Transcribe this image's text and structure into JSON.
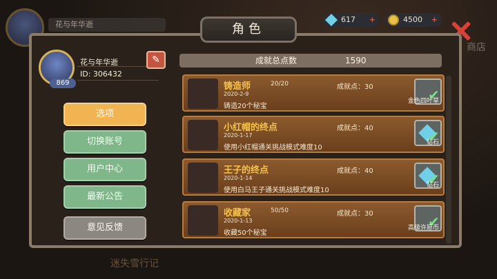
{
  "background": {
    "player_name": "花与年华逝",
    "shop_label": "商店",
    "bottom_text": "迷失雪行记"
  },
  "currency": {
    "gems": "617",
    "coins": "4500",
    "plus": "+"
  },
  "panel": {
    "title": "角色"
  },
  "profile": {
    "name": "花与年华逝",
    "id_label": "ID: 306432",
    "level": "869",
    "edit_icon": "pencil-icon"
  },
  "menu": [
    {
      "label": "选项",
      "state": "active"
    },
    {
      "label": "切换账号",
      "state": "normal"
    },
    {
      "label": "用户中心",
      "state": "normal"
    },
    {
      "label": "最新公告",
      "state": "normal"
    },
    {
      "label": "意见反馈",
      "state": "disabled"
    }
  ],
  "achievements": {
    "total_label": "成就总点数",
    "total_value": "1590",
    "items": [
      {
        "name": "铸造师",
        "progress": "20/20",
        "date": "2020-2-9",
        "desc": "铸造20个秘宝",
        "points": "成就点：30",
        "reward": "金色四叶草",
        "completed": true
      },
      {
        "name": "小红帽的终点",
        "progress": "",
        "date": "2020-1-17",
        "desc": "使用小红帽通关挑战模式难度10",
        "points": "成就点：40",
        "reward": "钻石",
        "completed": true
      },
      {
        "name": "王子的终点",
        "progress": "",
        "date": "2020-1-14",
        "desc": "使用白马王子通关挑战模式难度10",
        "points": "成就点：40",
        "reward": "钻石",
        "completed": true
      },
      {
        "name": "收藏家",
        "progress": "50/50",
        "date": "2020-1-13",
        "desc": "收藏50个秘宝",
        "points": "成就点：30",
        "reward": "高级许愿币",
        "completed": true
      }
    ]
  },
  "colors": {
    "accent": "#f0b452",
    "green_button": "#7fb78a",
    "card": "#8b5a2d",
    "close": "#d8413a"
  }
}
